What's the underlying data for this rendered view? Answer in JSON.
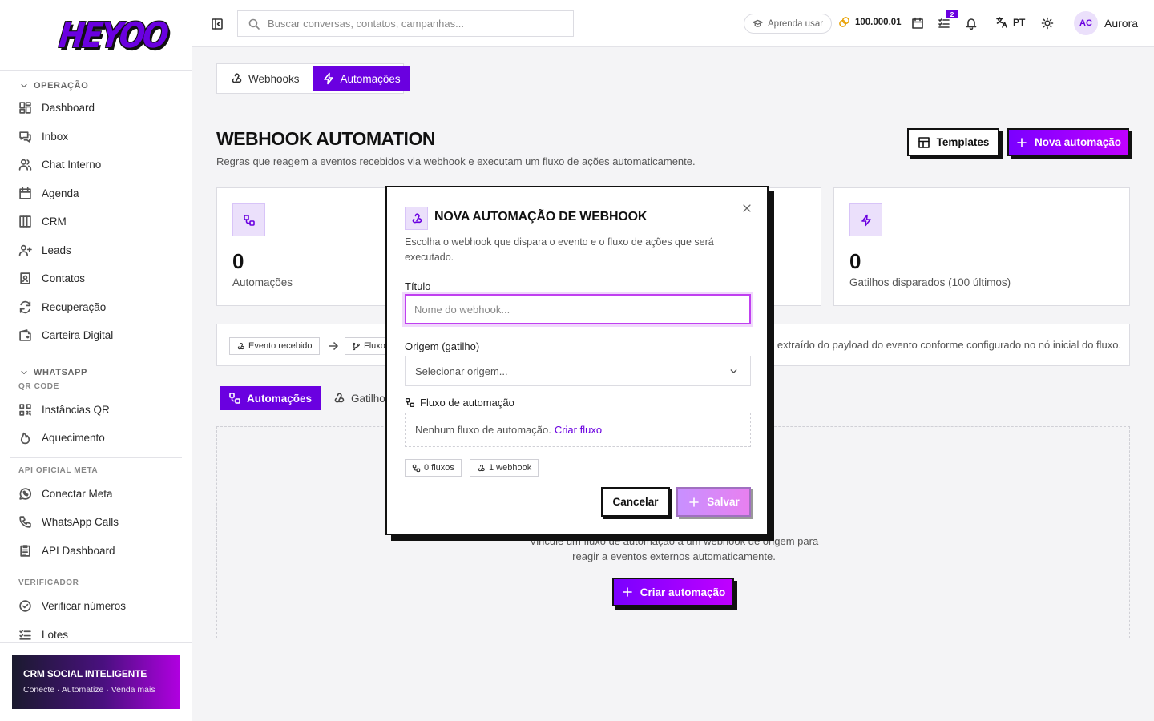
{
  "brand": {
    "logo": "HEYOO"
  },
  "sidebar": {
    "section_operacao": "OPERAÇÃO",
    "operacao_items": [
      "Dashboard",
      "Inbox",
      "Chat Interno",
      "Agenda",
      "CRM",
      "Leads",
      "Contatos",
      "Recuperação",
      "Carteira Digital"
    ],
    "section_whatsapp": "WHATSAPP",
    "sub_qr": "QR CODE",
    "qr_items": [
      "Instâncias QR",
      "Aquecimento"
    ],
    "sub_meta": "API OFICIAL META",
    "meta_items": [
      "Conectar Meta",
      "WhatsApp Calls",
      "API Dashboard"
    ],
    "sub_verificador": "VERIFICADOR",
    "verificador_items": [
      "Verificar números",
      "Lotes"
    ],
    "promo_title": "CRM SOCIAL INTELIGENTE",
    "promo_sub": "Conecte · Automatize · Venda mais"
  },
  "topbar": {
    "search_placeholder": "Buscar conversas, contatos, campanhas...",
    "learn": "Aprenda usar",
    "coins": "100.000,01",
    "tasks_badge": "2",
    "lang": "PT",
    "avatar_initials": "AC",
    "user_name": "Aurora"
  },
  "tabs": [
    {
      "label": "Webhooks"
    },
    {
      "label": "Automações"
    }
  ],
  "header": {
    "title": "WEBHOOK AUTOMATION",
    "subtitle": "Regras que reagem a eventos recebidos via webhook e executam um fluxo de ações automaticamente.",
    "templates_btn": "Templates",
    "new_btn": "Nova automação"
  },
  "stats": [
    {
      "value": "0",
      "label": "Automações"
    },
    {
      "value": "0",
      "label": "Gatilhos disparados (100 últimos)"
    }
  ],
  "strip": {
    "chip1": "Evento recebido",
    "chip2": "Fluxo",
    "text": "é extraído do payload do evento conforme configurado no nó inicial do fluxo."
  },
  "inner_tabs": [
    {
      "label": "Automações"
    },
    {
      "label": "Gatilhos"
    }
  ],
  "empty": {
    "line1": "Vincule um fluxo de automação a um webhook de origem para",
    "line2": "reagir a eventos externos automaticamente.",
    "button": "Criar automação"
  },
  "modal": {
    "title": "NOVA AUTOMAÇÃO DE WEBHOOK",
    "description": "Escolha o webhook que dispara o evento e o fluxo de ações que será executado.",
    "title_label": "Título",
    "title_placeholder": "Nome do webhook...",
    "origin_label": "Origem (gatilho)",
    "origin_value": "Selecionar origem...",
    "flow_label": "Fluxo de automação",
    "flow_empty": "Nenhum fluxo de automação.",
    "flow_link": "Criar fluxo",
    "chip_flows": "0 fluxos",
    "chip_webhooks": "1 webhook",
    "cancel": "Cancelar",
    "save": "Salvar"
  },
  "colors": {
    "accent": "#6a00e0",
    "accent_light": "#ebe0fb",
    "border_dark": "#111111"
  }
}
